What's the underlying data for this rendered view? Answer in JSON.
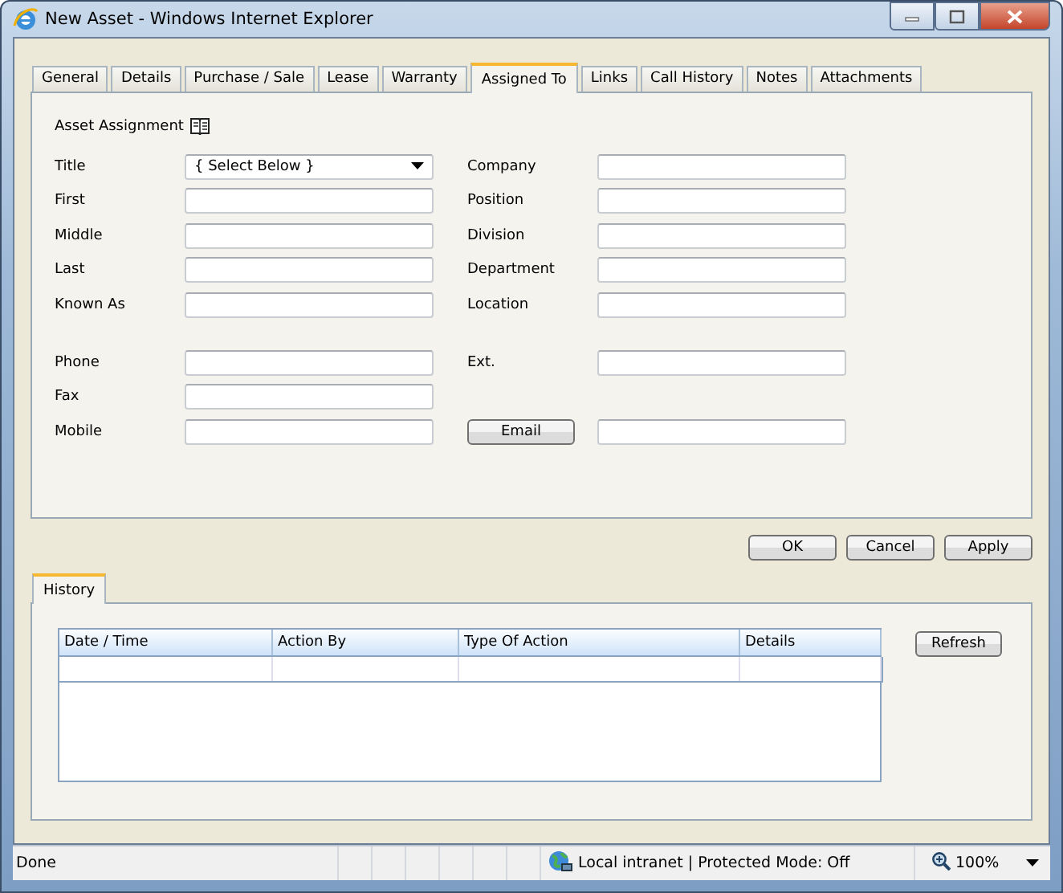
{
  "window": {
    "title": "New Asset - Windows Internet Explorer"
  },
  "tabs": [
    {
      "label": "General",
      "selected": false
    },
    {
      "label": "Details",
      "selected": false
    },
    {
      "label": "Purchase / Sale",
      "selected": false
    },
    {
      "label": "Lease",
      "selected": false
    },
    {
      "label": "Warranty",
      "selected": false
    },
    {
      "label": "Assigned To",
      "selected": true
    },
    {
      "label": "Links",
      "selected": false
    },
    {
      "label": "Call History",
      "selected": false
    },
    {
      "label": "Notes",
      "selected": false
    },
    {
      "label": "Attachments",
      "selected": false
    }
  ],
  "section_title": "Asset Assignment",
  "form_groups": [
    [
      {
        "left": {
          "label": "Title",
          "kind": "select",
          "value": "{ Select Below }"
        },
        "right": {
          "label": "Company",
          "kind": "text"
        }
      },
      {
        "left": {
          "label": "First",
          "kind": "text"
        },
        "right": {
          "label": "Position",
          "kind": "text"
        }
      },
      {
        "left": {
          "label": "Middle",
          "kind": "text"
        },
        "right": {
          "label": "Division",
          "kind": "text"
        }
      },
      {
        "left": {
          "label": "Last",
          "kind": "text"
        },
        "right": {
          "label": "Department",
          "kind": "text"
        }
      },
      {
        "left": {
          "label": "Known As",
          "kind": "text"
        },
        "right": {
          "label": "Location",
          "kind": "text"
        }
      }
    ],
    [
      {
        "left": {
          "label": "Phone",
          "kind": "text"
        },
        "right": {
          "label": "Ext.",
          "kind": "text"
        }
      },
      {
        "left": {
          "label": "Fax",
          "kind": "text"
        }
      },
      {
        "left": {
          "label": "Mobile",
          "kind": "text"
        },
        "right": {
          "label": "Email",
          "kind": "button"
        }
      }
    ]
  ],
  "buttons": [
    "OK",
    "Cancel",
    "Apply"
  ],
  "history": {
    "tab": {
      "label": "History",
      "selected": true
    },
    "columns": [
      "Date / Time",
      "Action By",
      "Type Of Action",
      "Details"
    ],
    "refresh": "Refresh"
  },
  "status_bar": {
    "text": "Done",
    "zone": "Local intranet | Protected Mode: Off",
    "zoom": "100%"
  }
}
